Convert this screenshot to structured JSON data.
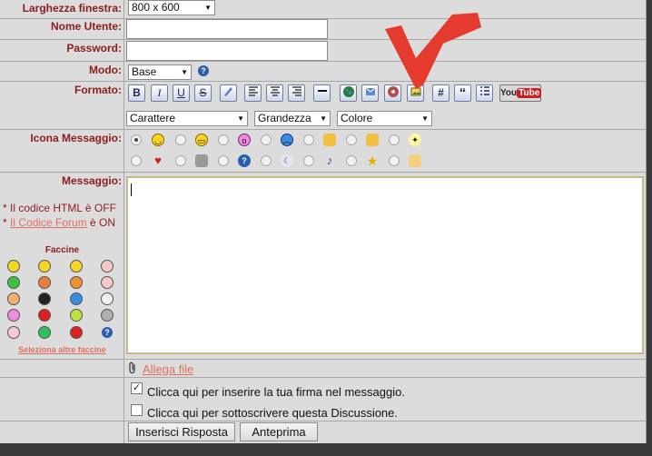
{
  "fields": {
    "window_size": {
      "label": "Larghezza finestra:",
      "value": "800 x 600"
    },
    "username": {
      "label": "Nome Utente:",
      "value": ""
    },
    "password": {
      "label": "Password:",
      "value": ""
    },
    "mode": {
      "label": "Modo:",
      "value": "Base",
      "help": "?"
    },
    "format": {
      "label": "Formato:"
    },
    "icon": {
      "label": "Icona Messaggio:"
    },
    "message": {
      "label": "Messaggio:"
    }
  },
  "toolbar": {
    "bold": "B",
    "italic": "I",
    "underline": "U",
    "strike": "S",
    "quote_block": "#",
    "quote": "“",
    "youtube_you": "You",
    "youtube_tube": "Tube"
  },
  "format_selects": {
    "font": "Carattere",
    "size": "Grandezza",
    "color": "Colore"
  },
  "notes": {
    "html_prefix": "* Il codice HTML è OFF",
    "forum_link": "Il Codice Forum",
    "forum_suffix": " è ON"
  },
  "smileys": {
    "title": "Faccine",
    "more_link": "Seleziona altre faccine",
    "help": "?"
  },
  "attach": {
    "label": "Allega file"
  },
  "options": {
    "signature": {
      "label": "Clicca qui per inserire la tua firma nel messaggio.",
      "checked": true
    },
    "subscribe": {
      "label": "Clicca qui per sottoscrivere questa Discussione.",
      "checked": false
    }
  },
  "buttons": {
    "submit": "Inserisci Risposta",
    "preview": "Anteprima"
  },
  "colors": {
    "label": "#8b1c1c",
    "link": "#e07060",
    "arrow": "#e53a2e"
  }
}
